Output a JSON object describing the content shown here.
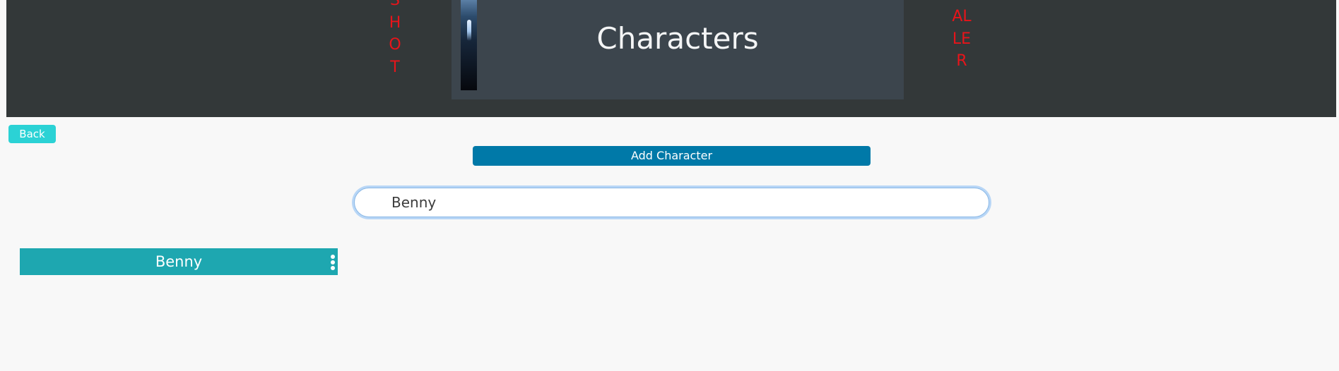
{
  "header": {
    "title": "Characters",
    "left_vertical_text": "SHOT",
    "right_vertical_text": "ALLER",
    "background_color": "#333839",
    "panel_color": "#3c454d",
    "accent_text_color": "#e8141a"
  },
  "toolbar": {
    "back_label": "Back",
    "add_character_label": "Add Character"
  },
  "search": {
    "value": "Benny",
    "placeholder": ""
  },
  "characters": [
    {
      "name": "Benny"
    }
  ],
  "icons": {
    "title_image": "character-image",
    "menu": "more-vertical-icon"
  },
  "colors": {
    "back_button": "#2bd2d5",
    "add_button": "#0079a8",
    "character_card": "#1ea7b0",
    "search_focus": "#b8d6f6"
  }
}
